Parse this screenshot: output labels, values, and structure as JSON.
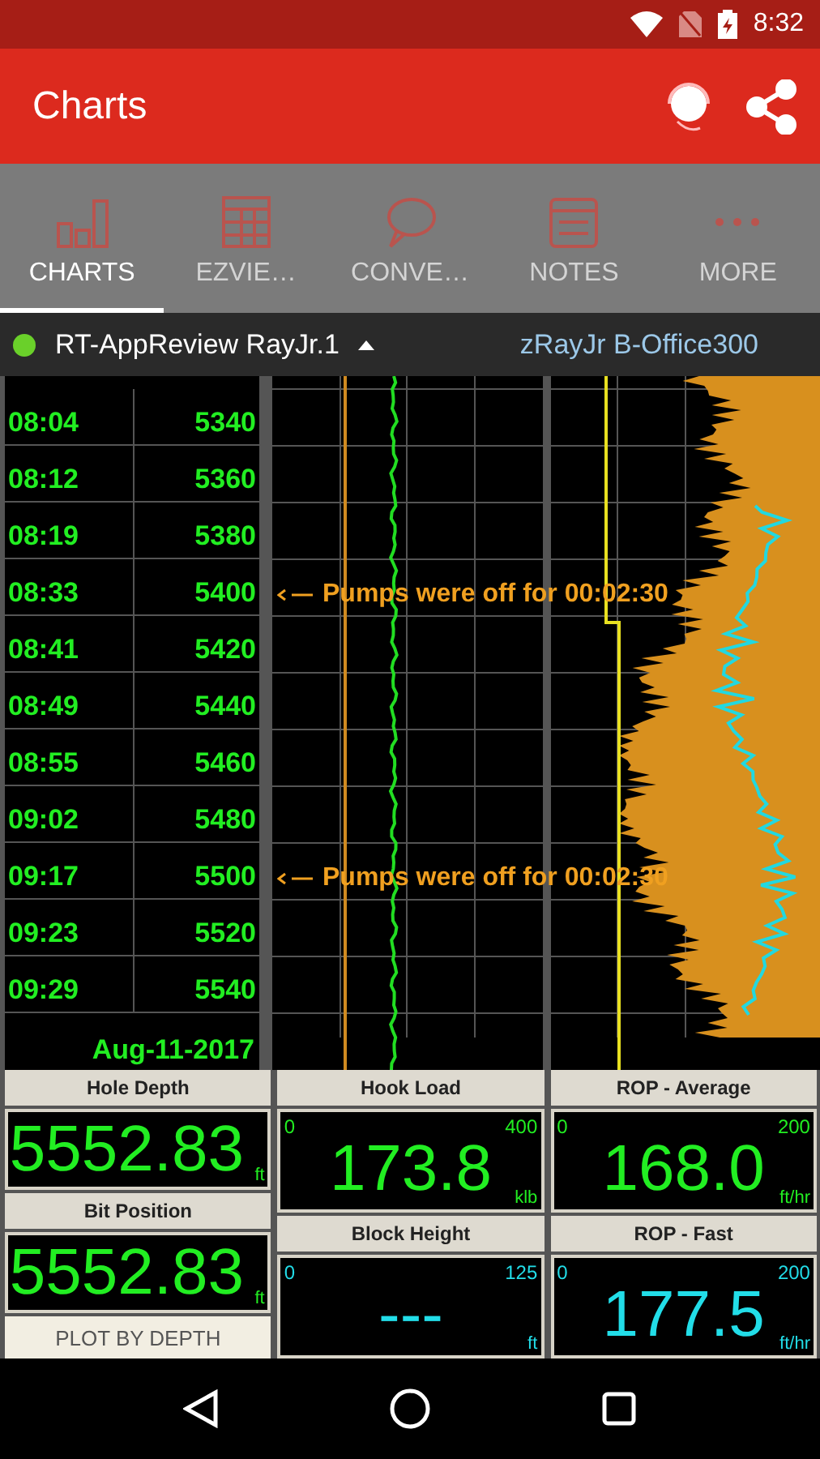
{
  "status_bar": {
    "time": "8:32"
  },
  "app_bar": {
    "title": "Charts"
  },
  "tabs": [
    {
      "label": "CHARTS",
      "selected": true
    },
    {
      "label": "EZVIE…",
      "selected": false
    },
    {
      "label": "CONVE…",
      "selected": false
    },
    {
      "label": "NOTES",
      "selected": false
    },
    {
      "label": "MORE",
      "selected": false
    }
  ],
  "well_header": {
    "name": "RT-AppReview RayJr.1",
    "server": "zRayJr B-Office300"
  },
  "log": {
    "rows": [
      {
        "time": "08:04",
        "depth": "5340"
      },
      {
        "time": "08:12",
        "depth": "5360"
      },
      {
        "time": "08:19",
        "depth": "5380"
      },
      {
        "time": "08:33",
        "depth": "5400",
        "annotation": "Pumps were off for 00:02:30"
      },
      {
        "time": "08:41",
        "depth": "5420"
      },
      {
        "time": "08:49",
        "depth": "5440"
      },
      {
        "time": "08:55",
        "depth": "5460"
      },
      {
        "time": "09:02",
        "depth": "5480"
      },
      {
        "time": "09:17",
        "depth": "5500",
        "annotation": "Pumps were off for 00:02:30"
      },
      {
        "time": "09:23",
        "depth": "5520"
      },
      {
        "time": "09:29",
        "depth": "5540"
      }
    ],
    "date": "Aug-11-2017"
  },
  "gauges": [
    [
      {
        "kind": "readout",
        "label": "Hole Depth",
        "value": "5552.83",
        "unit": "ft",
        "color": "#22ee22"
      },
      {
        "kind": "readout",
        "label": "Bit Position",
        "value": "5552.83",
        "unit": "ft",
        "color": "#22ee22"
      },
      {
        "kind": "button",
        "label": "PLOT BY DEPTH"
      }
    ],
    [
      {
        "kind": "dial",
        "label": "Hook Load",
        "min": "0",
        "max": "400",
        "value": "173.8",
        "unit": "klb",
        "color": "#22ee22"
      },
      {
        "kind": "dial",
        "label": "Block Height",
        "min": "0",
        "max": "125",
        "value": "---",
        "unit": "ft",
        "color": "#22dde8"
      }
    ],
    [
      {
        "kind": "dial",
        "label": "ROP - Average",
        "min": "0",
        "max": "200",
        "value": "168.0",
        "unit": "ft/hr",
        "color": "#22ee22"
      },
      {
        "kind": "dial",
        "label": "ROP - Fast",
        "min": "0",
        "max": "200",
        "value": "177.5",
        "unit": "ft/hr",
        "color": "#22dde8"
      }
    ]
  ]
}
